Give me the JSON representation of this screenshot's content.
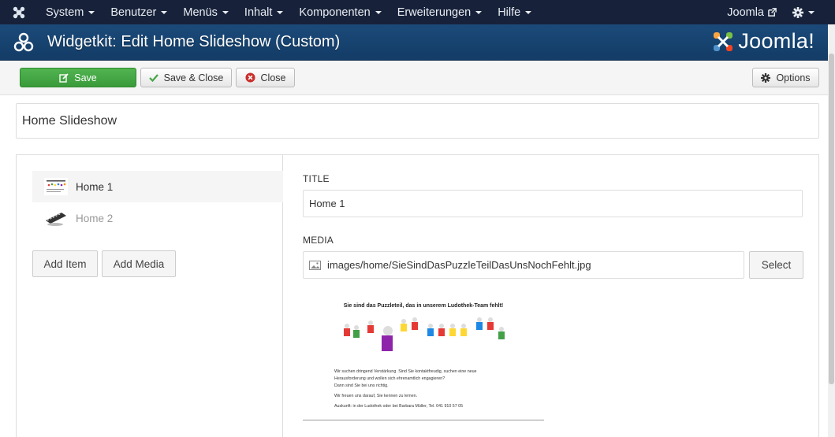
{
  "navbar": {
    "menus": [
      "System",
      "Benutzer",
      "Menüs",
      "Inhalt",
      "Komponenten",
      "Erweiterungen",
      "Hilfe"
    ],
    "site_link": "Joomla",
    "icons": [
      "joomla-logo-icon",
      "external-link-icon",
      "gear-icon"
    ]
  },
  "header": {
    "title": "Widgetkit: Edit Home Slideshow (Custom)",
    "brand": "Joomla!"
  },
  "toolbar": {
    "save_label": "Save",
    "save_close_label": "Save & Close",
    "close_label": "Close",
    "options_label": "Options"
  },
  "widget": {
    "name": "Home Slideshow"
  },
  "items": [
    {
      "label": "Home 1",
      "active": true
    },
    {
      "label": "Home 2",
      "active": false
    }
  ],
  "panel": {
    "add_item_label": "Add Item",
    "add_media_label": "Add Media"
  },
  "form": {
    "title_label": "TITLE",
    "title_value": "Home 1",
    "media_label": "MEDIA",
    "media_value": "images/home/SieSindDasPuzzleTeilDasUnsNochFehlt.jpg",
    "select_label": "Select"
  },
  "preview": {
    "heading": "Sie sind das Puzzleteil, das in unserem Ludothek-Team fehlt!",
    "lines": [
      "Wir suchen dringend Verstärkung. Sind Sie kontaktfreudig, suchen eine neue",
      "Herausforderung und wollen sich ehrenamtlich engagieren?",
      "Dann sind Sie bei uns richtig.",
      "Wir freuen uns darauf, Sie kennen zu lernen.",
      "Auskunft: in der Ludothek oder bei Barbara Müller, Tel. 041 910 57 05"
    ]
  },
  "colors": {
    "navbar_bg": "#17223a",
    "header_bg": "#1b4a7a",
    "save_green": "#46a546",
    "close_red": "#c9302c"
  }
}
